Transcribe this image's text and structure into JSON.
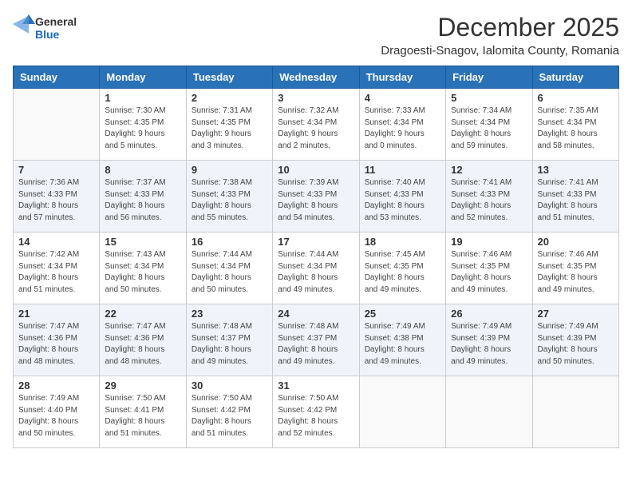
{
  "logo": {
    "general": "General",
    "blue": "Blue"
  },
  "title": {
    "month": "December 2025",
    "location": "Dragoesti-Snagov, Ialomita County, Romania"
  },
  "weekdays": [
    "Sunday",
    "Monday",
    "Tuesday",
    "Wednesday",
    "Thursday",
    "Friday",
    "Saturday"
  ],
  "weeks": [
    [
      {
        "day": "",
        "info": ""
      },
      {
        "day": "1",
        "info": "Sunrise: 7:30 AM\nSunset: 4:35 PM\nDaylight: 9 hours\nand 5 minutes."
      },
      {
        "day": "2",
        "info": "Sunrise: 7:31 AM\nSunset: 4:35 PM\nDaylight: 9 hours\nand 3 minutes."
      },
      {
        "day": "3",
        "info": "Sunrise: 7:32 AM\nSunset: 4:34 PM\nDaylight: 9 hours\nand 2 minutes."
      },
      {
        "day": "4",
        "info": "Sunrise: 7:33 AM\nSunset: 4:34 PM\nDaylight: 9 hours\nand 0 minutes."
      },
      {
        "day": "5",
        "info": "Sunrise: 7:34 AM\nSunset: 4:34 PM\nDaylight: 8 hours\nand 59 minutes."
      },
      {
        "day": "6",
        "info": "Sunrise: 7:35 AM\nSunset: 4:34 PM\nDaylight: 8 hours\nand 58 minutes."
      }
    ],
    [
      {
        "day": "7",
        "info": "Sunrise: 7:36 AM\nSunset: 4:33 PM\nDaylight: 8 hours\nand 57 minutes."
      },
      {
        "day": "8",
        "info": "Sunrise: 7:37 AM\nSunset: 4:33 PM\nDaylight: 8 hours\nand 56 minutes."
      },
      {
        "day": "9",
        "info": "Sunrise: 7:38 AM\nSunset: 4:33 PM\nDaylight: 8 hours\nand 55 minutes."
      },
      {
        "day": "10",
        "info": "Sunrise: 7:39 AM\nSunset: 4:33 PM\nDaylight: 8 hours\nand 54 minutes."
      },
      {
        "day": "11",
        "info": "Sunrise: 7:40 AM\nSunset: 4:33 PM\nDaylight: 8 hours\nand 53 minutes."
      },
      {
        "day": "12",
        "info": "Sunrise: 7:41 AM\nSunset: 4:33 PM\nDaylight: 8 hours\nand 52 minutes."
      },
      {
        "day": "13",
        "info": "Sunrise: 7:41 AM\nSunset: 4:33 PM\nDaylight: 8 hours\nand 51 minutes."
      }
    ],
    [
      {
        "day": "14",
        "info": "Sunrise: 7:42 AM\nSunset: 4:34 PM\nDaylight: 8 hours\nand 51 minutes."
      },
      {
        "day": "15",
        "info": "Sunrise: 7:43 AM\nSunset: 4:34 PM\nDaylight: 8 hours\nand 50 minutes."
      },
      {
        "day": "16",
        "info": "Sunrise: 7:44 AM\nSunset: 4:34 PM\nDaylight: 8 hours\nand 50 minutes."
      },
      {
        "day": "17",
        "info": "Sunrise: 7:44 AM\nSunset: 4:34 PM\nDaylight: 8 hours\nand 49 minutes."
      },
      {
        "day": "18",
        "info": "Sunrise: 7:45 AM\nSunset: 4:35 PM\nDaylight: 8 hours\nand 49 minutes."
      },
      {
        "day": "19",
        "info": "Sunrise: 7:46 AM\nSunset: 4:35 PM\nDaylight: 8 hours\nand 49 minutes."
      },
      {
        "day": "20",
        "info": "Sunrise: 7:46 AM\nSunset: 4:35 PM\nDaylight: 8 hours\nand 49 minutes."
      }
    ],
    [
      {
        "day": "21",
        "info": "Sunrise: 7:47 AM\nSunset: 4:36 PM\nDaylight: 8 hours\nand 48 minutes."
      },
      {
        "day": "22",
        "info": "Sunrise: 7:47 AM\nSunset: 4:36 PM\nDaylight: 8 hours\nand 48 minutes."
      },
      {
        "day": "23",
        "info": "Sunrise: 7:48 AM\nSunset: 4:37 PM\nDaylight: 8 hours\nand 49 minutes."
      },
      {
        "day": "24",
        "info": "Sunrise: 7:48 AM\nSunset: 4:37 PM\nDaylight: 8 hours\nand 49 minutes."
      },
      {
        "day": "25",
        "info": "Sunrise: 7:49 AM\nSunset: 4:38 PM\nDaylight: 8 hours\nand 49 minutes."
      },
      {
        "day": "26",
        "info": "Sunrise: 7:49 AM\nSunset: 4:39 PM\nDaylight: 8 hours\nand 49 minutes."
      },
      {
        "day": "27",
        "info": "Sunrise: 7:49 AM\nSunset: 4:39 PM\nDaylight: 8 hours\nand 50 minutes."
      }
    ],
    [
      {
        "day": "28",
        "info": "Sunrise: 7:49 AM\nSunset: 4:40 PM\nDaylight: 8 hours\nand 50 minutes."
      },
      {
        "day": "29",
        "info": "Sunrise: 7:50 AM\nSunset: 4:41 PM\nDaylight: 8 hours\nand 51 minutes."
      },
      {
        "day": "30",
        "info": "Sunrise: 7:50 AM\nSunset: 4:42 PM\nDaylight: 8 hours\nand 51 minutes."
      },
      {
        "day": "31",
        "info": "Sunrise: 7:50 AM\nSunset: 4:42 PM\nDaylight: 8 hours\nand 52 minutes."
      },
      {
        "day": "",
        "info": ""
      },
      {
        "day": "",
        "info": ""
      },
      {
        "day": "",
        "info": ""
      }
    ]
  ]
}
